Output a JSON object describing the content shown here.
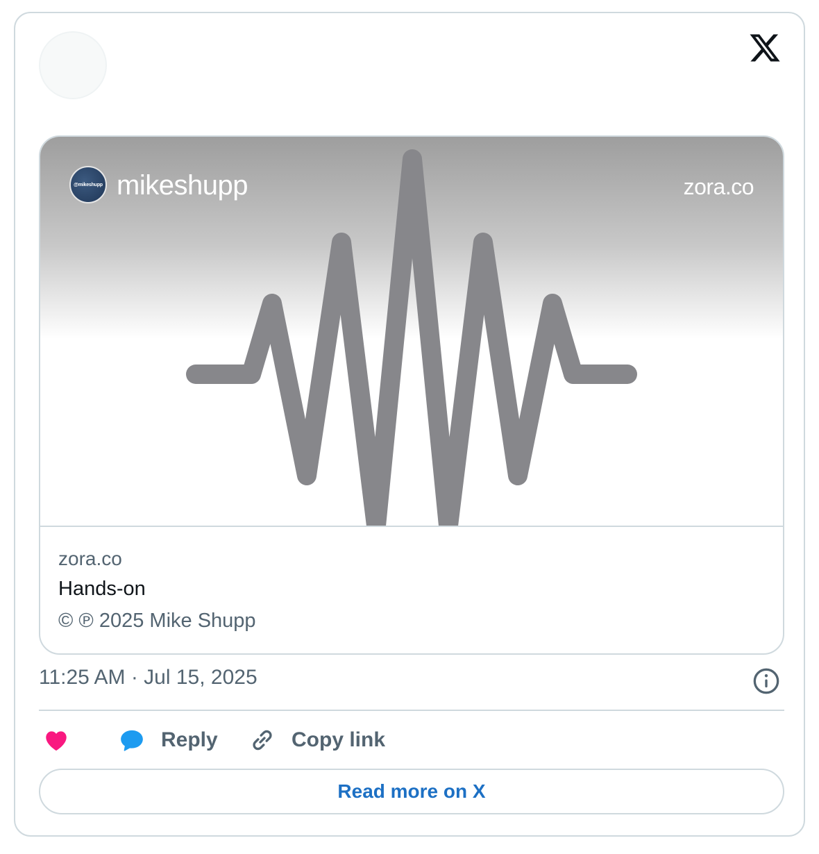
{
  "header": {
    "logo_icon": "x-logo-icon"
  },
  "card": {
    "image": {
      "username": "mikeshupp",
      "domain": "zora.co",
      "avatar_text": "@mikeshupp",
      "graphic": "waveform"
    },
    "meta": {
      "domain": "zora.co",
      "title": "Hands-on",
      "description": "© ℗ 2025 Mike Shupp"
    }
  },
  "timestamp": "11:25 AM · Jul 15, 2025",
  "actions": {
    "like_icon": "heart-icon",
    "reply_label": "Reply",
    "copy_label": "Copy link"
  },
  "read_more_label": "Read more on X",
  "colors": {
    "heart": "#f91880",
    "reply": "#1d9bf0",
    "link_blue": "#1d70c4",
    "muted": "#536471",
    "waveform": "#87878b"
  }
}
